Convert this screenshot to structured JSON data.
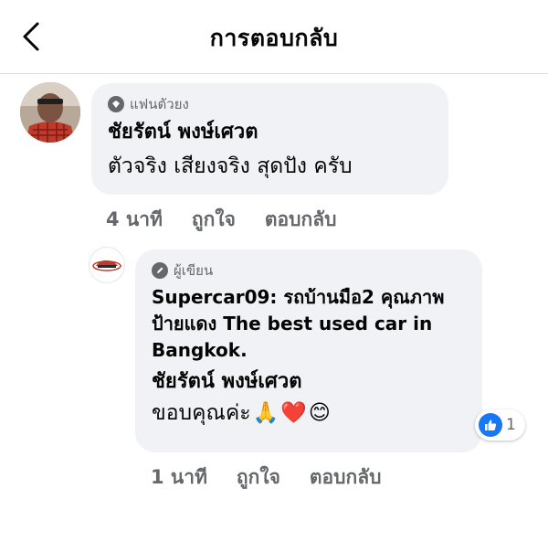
{
  "header": {
    "title": "การตอบกลับ",
    "back_icon": "chevron-left-icon"
  },
  "comment": {
    "badge_label": "แฟนตัวยง",
    "badge_icon": "diamond-icon",
    "author": "ชัยรัตน์ พงษ์เศวต",
    "text": "ตัวจริง เสียงจริง สุดปัง ครับ",
    "time": "4 นาที",
    "like_label": "ถูกใจ",
    "reply_label": "ตอบกลับ"
  },
  "reply": {
    "badge_label": "ผู้เขียน",
    "badge_icon": "pencil-icon",
    "page_name": "Supercar09: รถบ้านมือ2 คุณภาพป้ายแดง The best used car in Bangkok.",
    "mention": "ชัยรัตน์ พงษ์เศวต",
    "text": "ขอบคุณค่ะ",
    "emojis": [
      "🙏",
      "❤️",
      "😊"
    ],
    "time": "1 นาที",
    "like_label": "ถูกใจ",
    "reply_label": "ตอบกลับ",
    "reaction_count": "1",
    "reaction_icon": "thumbs-up-icon"
  },
  "colors": {
    "bubble": "#f0f2f5",
    "secondary_text": "#65676b",
    "like_blue": "#1877f2"
  }
}
